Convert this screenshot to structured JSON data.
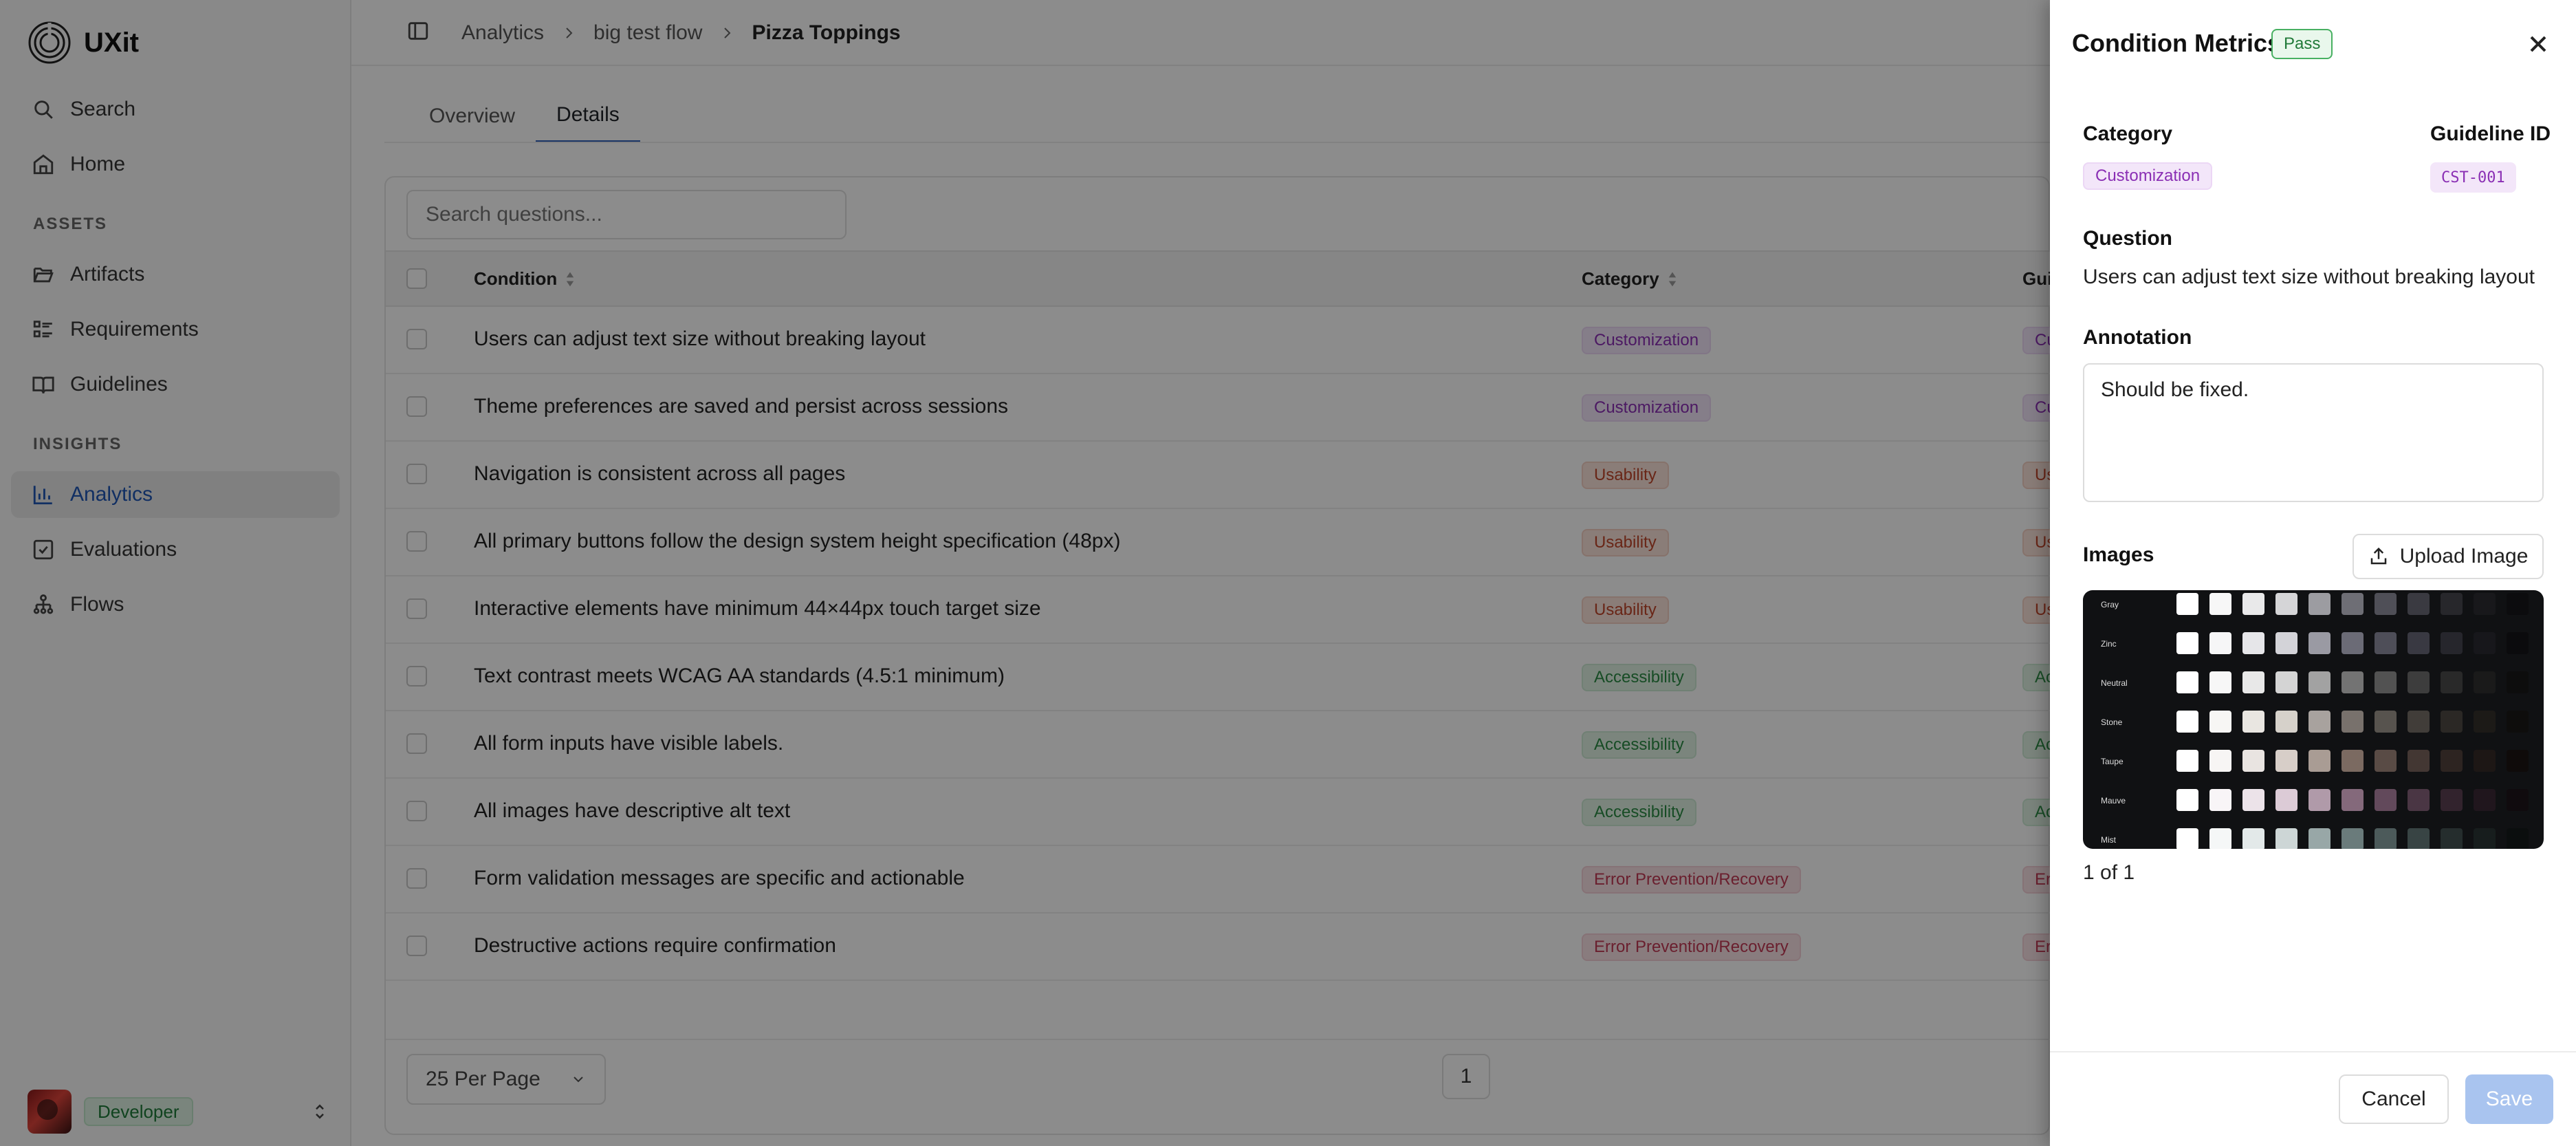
{
  "app": {
    "name": "UXit"
  },
  "sidebar": {
    "search_label": "Search",
    "home_label": "Home",
    "assets_heading": "ASSETS",
    "assets": [
      {
        "label": "Artifacts",
        "icon": "folder-open-icon"
      },
      {
        "label": "Requirements",
        "icon": "list-icon"
      },
      {
        "label": "Guidelines",
        "icon": "book-icon"
      }
    ],
    "insights_heading": "INSIGHTS",
    "insights": [
      {
        "label": "Analytics",
        "icon": "bar-chart-icon",
        "active": true
      },
      {
        "label": "Evaluations",
        "icon": "check-square-icon"
      },
      {
        "label": "Flows",
        "icon": "flows-icon"
      }
    ],
    "user_role": "Developer"
  },
  "breadcrumb": {
    "items": [
      "Analytics",
      "big test flow",
      "Pizza Toppings"
    ]
  },
  "tabs": [
    "Overview",
    "Details"
  ],
  "active_tab": "Details",
  "search": {
    "placeholder": "Search questions..."
  },
  "table": {
    "columns": {
      "condition": "Condition",
      "category": "Category",
      "guideline": "Gui"
    },
    "rows": [
      {
        "condition": "Users can adjust text size without breaking layout",
        "category": "Customization",
        "guideline_clipped": "Cu"
      },
      {
        "condition": "Theme preferences are saved and persist across sessions",
        "category": "Customization",
        "guideline_clipped": "Cu"
      },
      {
        "condition": "Navigation is consistent across all pages",
        "category": "Usability",
        "guideline_clipped": "Us"
      },
      {
        "condition": "All primary buttons follow the design system height specification (48px)",
        "category": "Usability",
        "guideline_clipped": "Us"
      },
      {
        "condition": "Interactive elements have minimum 44×44px touch target size",
        "category": "Usability",
        "guideline_clipped": "Us"
      },
      {
        "condition": "Text contrast meets WCAG AA standards (4.5:1 minimum)",
        "category": "Accessibility",
        "guideline_clipped": "Ac"
      },
      {
        "condition": "All form inputs have visible labels.",
        "category": "Accessibility",
        "guideline_clipped": "Ac"
      },
      {
        "condition": "All images have descriptive alt text",
        "category": "Accessibility",
        "guideline_clipped": "Ac"
      },
      {
        "condition": "Form validation messages are specific and actionable",
        "category": "Error Prevention/Recovery",
        "guideline_clipped": "Er"
      },
      {
        "condition": "Destructive actions require confirmation",
        "category": "Error Prevention/Recovery",
        "guideline_clipped": "Er"
      }
    ]
  },
  "pagination": {
    "per_page": "25 Per Page",
    "current_page": "1"
  },
  "drawer": {
    "title": "Condition Metrics",
    "status": "Pass",
    "category_label": "Category",
    "category_value": "Customization",
    "guideline_id_label": "Guideline ID",
    "guideline_id_value": "CST-001",
    "question_label": "Question",
    "question_value": "Users can adjust text size without breaking layout",
    "annotation_label": "Annotation",
    "annotation_value": "Should be fixed.",
    "images_label": "Images",
    "upload_label": "Upload Image",
    "image_counter": "1 of 1",
    "image_palette_rows": [
      "Gray",
      "Zinc",
      "Neutral",
      "Stone",
      "Taupe",
      "Mauve",
      "Mist"
    ],
    "cancel_label": "Cancel",
    "save_label": "Save"
  },
  "colors": {
    "accent": "#2f5fb8",
    "pass": "#217a39",
    "customization": "#8a2fb4",
    "usability": "#c0452a",
    "accessibility": "#2a8a44",
    "error": "#c23a55",
    "save_disabled": "#a9c4ef"
  }
}
